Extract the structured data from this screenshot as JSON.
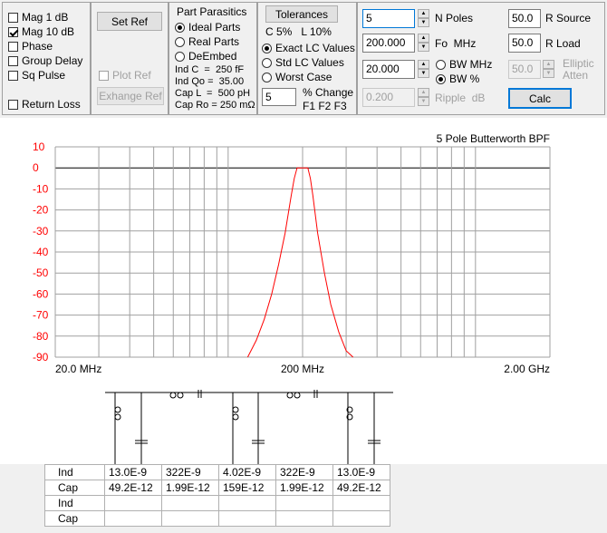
{
  "display_options": {
    "items": [
      {
        "label": "Mag   1 dB",
        "checked": false
      },
      {
        "label": "Mag 10 dB",
        "checked": true
      },
      {
        "label": "Phase",
        "checked": false
      },
      {
        "label": "Group Delay",
        "checked": false
      },
      {
        "label": "Sq Pulse",
        "checked": false
      }
    ],
    "return_loss": {
      "label": "Return Loss",
      "checked": false
    }
  },
  "ref": {
    "set_ref": "Set Ref",
    "plot_ref": "Plot Ref",
    "exchange_ref": "Exhange Ref"
  },
  "parasitics": {
    "title": "Part Parasitics",
    "options": [
      {
        "label": "Ideal Parts",
        "selected": true
      },
      {
        "label": "Real Parts",
        "selected": false
      },
      {
        "label": "DeEmbed",
        "selected": false
      }
    ],
    "values": [
      "Ind C  =  250 fF",
      "Ind Qo =  35.00",
      "Cap L  =  500 pH",
      "Cap Ro = 250 mΩ"
    ]
  },
  "tolerances": {
    "button": "Tolerances",
    "caption": "C 5%   L 10%",
    "options": [
      {
        "label": "Exact LC Values",
        "selected": true
      },
      {
        "label": "Std LC Values",
        "selected": false
      },
      {
        "label": "Worst Case",
        "selected": false
      }
    ],
    "pct_value": "5",
    "pct_label": "% Change",
    "f_label": "F1 F2 F3"
  },
  "design": {
    "n_poles": {
      "value": "5",
      "label": "N Poles"
    },
    "fo": {
      "value": "200.000",
      "label": "Fo  MHz"
    },
    "bw": {
      "value": "20.000"
    },
    "bw_mhz": {
      "label": "BW MHz",
      "selected": false
    },
    "bw_pct": {
      "label": "BW %",
      "selected": true
    },
    "ripple": {
      "value": "0.200",
      "label": "Ripple  dB"
    },
    "r_source": {
      "value": "50.0",
      "label": "R Source"
    },
    "r_load": {
      "value": "50.0",
      "label": "R Load"
    },
    "elliptic": {
      "value": "50.0",
      "label_1": "Elliptic",
      "label_2": "Atten"
    },
    "calc": "Calc"
  },
  "chart_data": {
    "type": "line",
    "title": "5 Pole Butterworth BPF",
    "xlabel": "",
    "ylabel": "",
    "x_scale": "log",
    "xlim": [
      20,
      2000
    ],
    "ylim": [
      -90,
      10
    ],
    "y_ticks": [
      "10",
      "0",
      "-10",
      "-20",
      "-30",
      "-40",
      "-50",
      "-60",
      "-70",
      "-80",
      "-90"
    ],
    "x_tick_labels": [
      "20.0 MHz",
      "200 MHz",
      "2.00 GHz"
    ],
    "grid": true,
    "series": [
      {
        "color": "#ff0000",
        "x": [
          120,
          130,
          140,
          150,
          160,
          170,
          180,
          185,
          190,
          200,
          210,
          215,
          220,
          230,
          245,
          260,
          280,
          300,
          320
        ],
        "y": [
          -90,
          -82,
          -72,
          -60,
          -46,
          -31,
          -13,
          -5,
          0,
          0,
          0,
          -5,
          -13,
          -31,
          -50,
          -65,
          -78,
          -87,
          -90
        ]
      }
    ]
  },
  "schematic": {
    "rows": [
      {
        "label": "Ind",
        "values": [
          "13.0E-9",
          "322E-9",
          "4.02E-9",
          "322E-9",
          "13.0E-9"
        ]
      },
      {
        "label": "Cap",
        "values": [
          "49.2E-12",
          "1.99E-12",
          "159E-12",
          "1.99E-12",
          "49.2E-12"
        ]
      },
      {
        "label": "Ind",
        "values": [
          "",
          "",
          "",
          "",
          ""
        ]
      },
      {
        "label": "Cap",
        "values": [
          "",
          "",
          "",
          "",
          ""
        ]
      }
    ]
  }
}
